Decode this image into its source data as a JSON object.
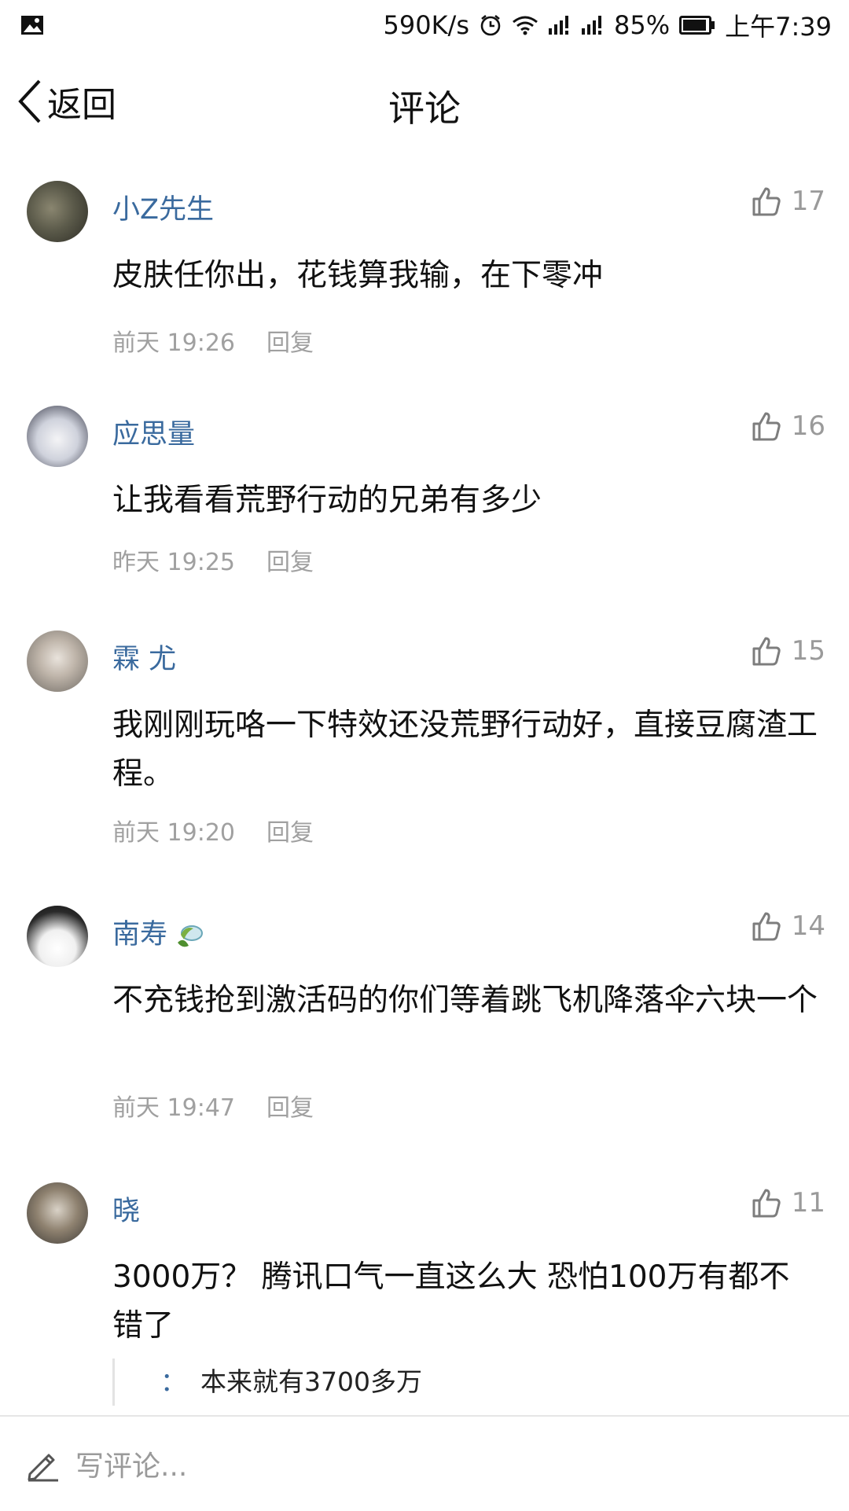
{
  "status_bar": {
    "speed": "590K/s",
    "battery": "85%",
    "time": "上午7:39"
  },
  "nav": {
    "back_label": "返回",
    "title": "评论"
  },
  "comments": [
    {
      "username": "小Z先生",
      "likes": "17",
      "text": "皮肤任你出，花钱算我输，在下零冲",
      "time": "前天 19:26",
      "reply_label": "回复"
    },
    {
      "username": "应思量",
      "likes": "16",
      "text": "让我看看荒野行动的兄弟有多少",
      "time": "昨天 19:25",
      "reply_label": "回复"
    },
    {
      "username": "霖 尤",
      "likes": "15",
      "text": "我刚刚玩咯一下特效还没荒野行动好，直接豆腐渣工程。",
      "time": "前天 19:20",
      "reply_label": "回复"
    },
    {
      "username": "南寿",
      "likes": "14",
      "text": "不充钱抢到激活码的你们等着跳飞机降落伞六块一个",
      "time": "前天 19:47",
      "reply_label": "回复"
    },
    {
      "username": "晓",
      "likes": "11",
      "text": "3000万？ 腾讯口气一直这么大 恐怕100万有都不错了",
      "sub_reply_colon": "：",
      "sub_reply_text": "本来就有3700多万"
    }
  ],
  "bottom_bar": {
    "placeholder": "写评论..."
  },
  "colors": {
    "username": "#3a6a9e",
    "meta": "#a0a0a0",
    "like_icon": "#7d7d7d"
  }
}
